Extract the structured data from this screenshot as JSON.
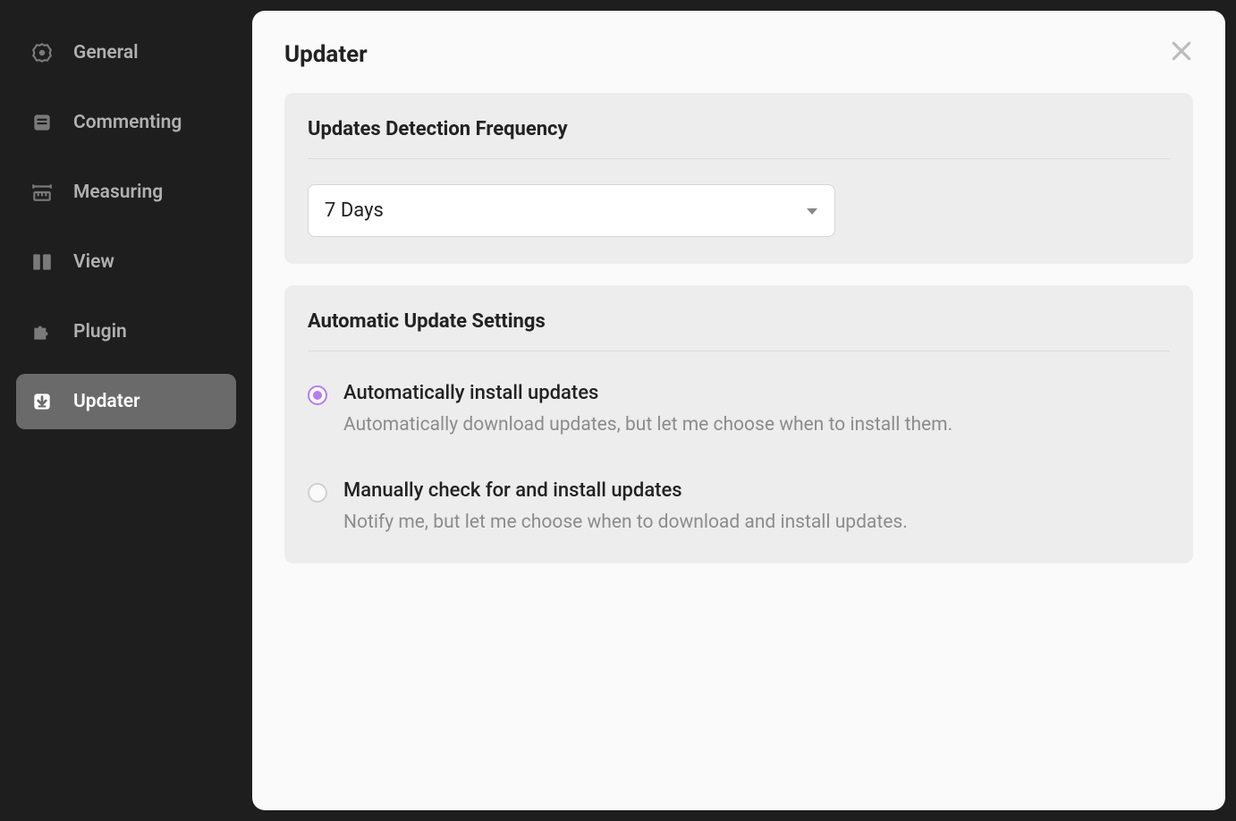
{
  "sidebar": {
    "items": [
      {
        "label": "General"
      },
      {
        "label": "Commenting"
      },
      {
        "label": "Measuring"
      },
      {
        "label": "View"
      },
      {
        "label": "Plugin"
      },
      {
        "label": "Updater"
      }
    ]
  },
  "page": {
    "title": "Updater"
  },
  "sections": {
    "frequency": {
      "title": "Updates Detection Frequency",
      "selected": "7 Days"
    },
    "autoUpdate": {
      "title": "Automatic Update Settings",
      "options": [
        {
          "label": "Automatically install updates",
          "desc": "Automatically download updates, but let me choose when to install them."
        },
        {
          "label": "Manually check for and install updates",
          "desc": "Notify me, but let me choose when to download and install updates."
        }
      ]
    }
  }
}
